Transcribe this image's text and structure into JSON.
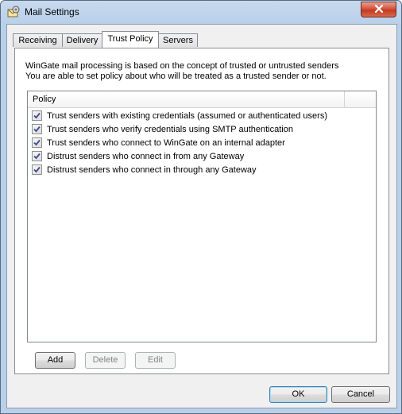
{
  "window": {
    "title": "Mail Settings"
  },
  "tabs": [
    {
      "label": "Receiving",
      "active": false
    },
    {
      "label": "Delivery",
      "active": false
    },
    {
      "label": "Trust Policy",
      "active": true
    },
    {
      "label": "Servers",
      "active": false
    }
  ],
  "trust_policy": {
    "description_line1": "WinGate mail processing is based on the concept of trusted or untrusted senders",
    "description_line2": "You are able to set policy about who will be treated as a trusted sender or not.",
    "column_header": "Policy",
    "policies": [
      {
        "label": "Trust senders with existing credentials (assumed or authenticated users)",
        "checked": true
      },
      {
        "label": "Trust senders who verify credentials using SMTP authentication",
        "checked": true
      },
      {
        "label": "Trust senders who connect to WinGate on an internal adapter",
        "checked": true
      },
      {
        "label": "Distrust senders who connect in from any Gateway",
        "checked": true
      },
      {
        "label": "Distrust senders who connect in through any Gateway",
        "checked": true
      }
    ],
    "buttons": {
      "add": "Add",
      "delete": "Delete",
      "edit": "Edit"
    }
  },
  "dialog_buttons": {
    "ok": "OK",
    "cancel": "Cancel"
  },
  "icons": {
    "app": "mail-settings-icon",
    "close": "close-icon",
    "check": "checkmark-icon"
  },
  "colors": {
    "close_button": "#c94a33",
    "title_bar": "#b9d0ea",
    "default_button_border": "#3c7fb1"
  }
}
